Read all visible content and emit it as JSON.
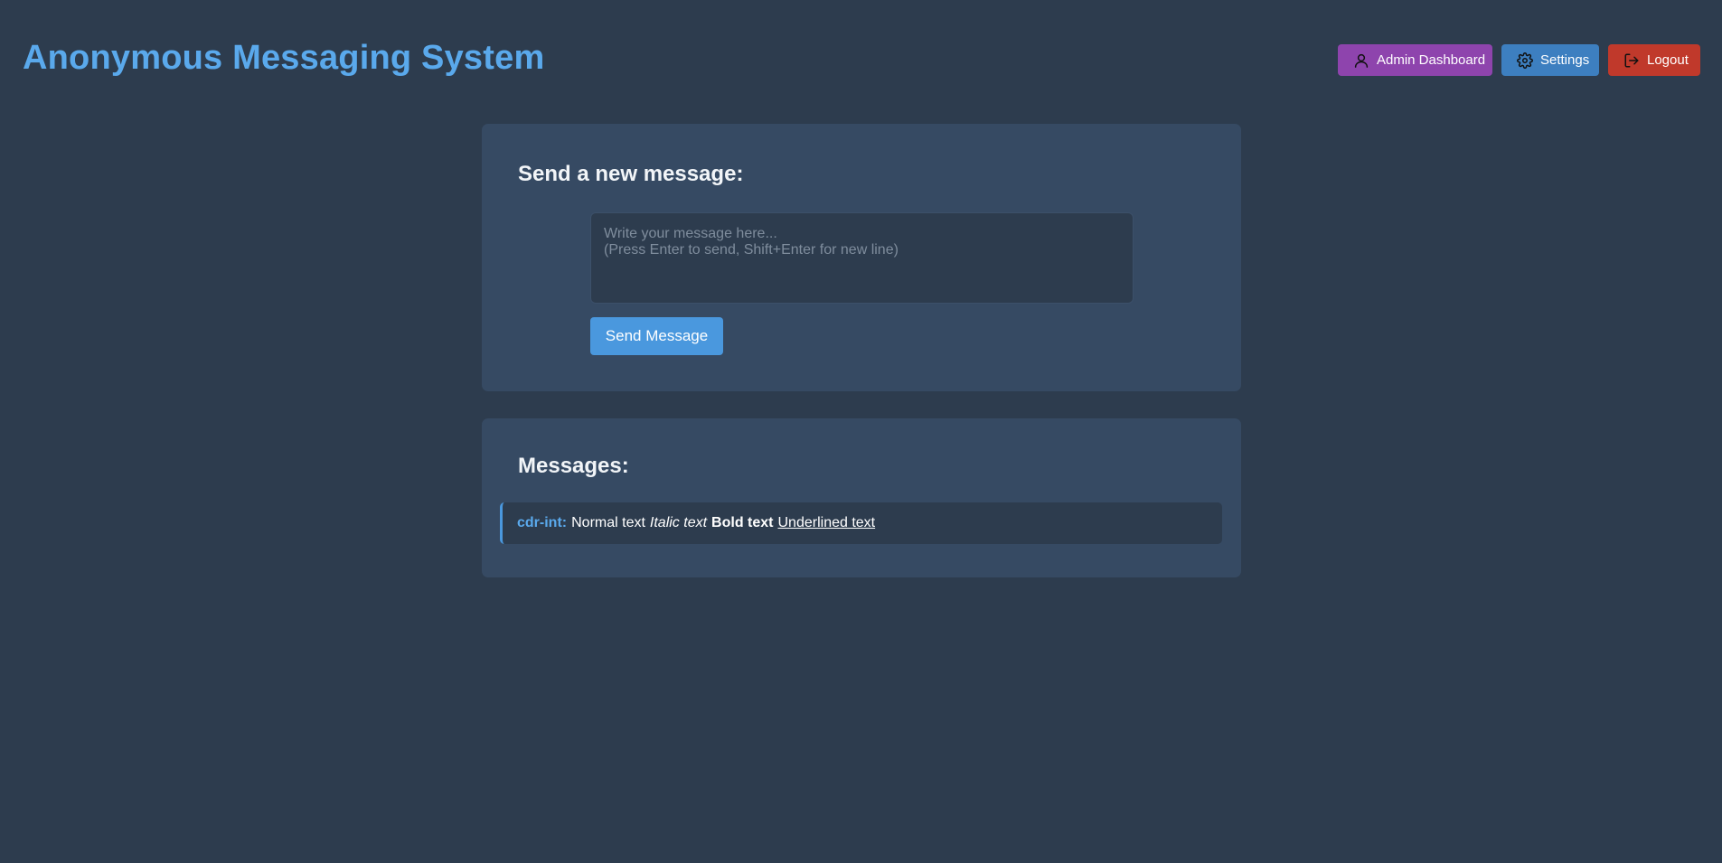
{
  "app": {
    "title": "Anonymous Messaging System"
  },
  "nav": {
    "admin_label": "Admin Dashboard",
    "admin_icon": "user-icon",
    "settings_label": "Settings",
    "settings_icon": "gear-icon",
    "logout_label": "Logout",
    "logout_icon": "logout-icon"
  },
  "compose": {
    "heading": "Send a new message:",
    "placeholder": "Write your message here...\n(Press Enter to send, Shift+Enter for new line)",
    "value": "",
    "send_label": "Send Message"
  },
  "messages": {
    "heading": "Messages:",
    "items": [
      {
        "author": "cdr-int",
        "separator": ":",
        "segments": {
          "normal": "Normal text",
          "italic": "Italic text",
          "bold": "Bold text",
          "underline": "Underlined text"
        }
      }
    ]
  },
  "colors": {
    "background": "#2d3c4e",
    "card": "#364a63",
    "accent": "#5aa9ec",
    "send_button": "#4a98de",
    "admin_button": "#8e44ad",
    "settings_button": "#3d7fc0",
    "logout_button": "#c0392b"
  }
}
